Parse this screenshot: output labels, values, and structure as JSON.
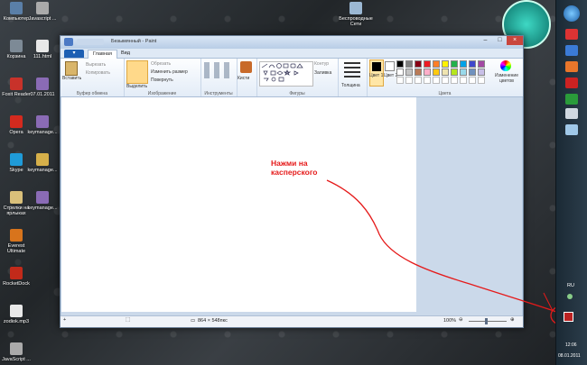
{
  "desktop": {
    "icons": [
      {
        "label": "Компьютер",
        "color": "#5a7fa8"
      },
      {
        "label": "Корзина",
        "color": "#7d8a96"
      },
      {
        "label": "Foxit Reader",
        "color": "#c8322a"
      },
      {
        "label": "Opera",
        "color": "#d42a1e"
      },
      {
        "label": "Skype",
        "color": "#1f9bd8"
      },
      {
        "label": "Стрелки на ярлыках",
        "color": "#d9c07a"
      },
      {
        "label": "Everest Ultimate",
        "color": "#d8741c"
      },
      {
        "label": "RocketDock",
        "color": "#c22a1a"
      },
      {
        "label": "zodiok.mp3",
        "color": "#e8e8e8"
      },
      {
        "label": "JavaScript ...",
        "color": "#aaaaaa"
      }
    ],
    "icons_col2": [
      {
        "label": "Javascript ...",
        "color": "#aaaaaa"
      },
      {
        "label": "111.html",
        "color": "#e8e8e8"
      },
      {
        "label": "07.01.2011",
        "color": "#8a6bb5"
      },
      {
        "label": "keymanage...",
        "color": "#8a6bb5"
      },
      {
        "label": "keymanage...",
        "color": "#d6b04a"
      },
      {
        "label": "keymanage...",
        "color": "#8a6bb5"
      }
    ],
    "top_icon_label": "Беспроводные Сети"
  },
  "paint": {
    "title": "Безымянный - Paint",
    "file_tab": "▾",
    "tabs": [
      "Главная",
      "Вид"
    ],
    "groups": {
      "clipboard": {
        "label": "Буфер обмена",
        "paste": "Вставить",
        "cut": "Вырезать",
        "copy": "Копировать"
      },
      "image": {
        "label": "Изображение",
        "select": "Выделить",
        "crop": "Обрезать",
        "resize": "Изменить размер",
        "rotate": "Повернуть"
      },
      "tools": {
        "label": "Инструменты"
      },
      "brushes": {
        "label": "Кисти"
      },
      "shapes": {
        "label": "Фигуры",
        "outline": "Контур",
        "fill": "Заливка"
      },
      "size": {
        "label": "Толщина"
      },
      "colors": {
        "label": "Цвета",
        "color1": "Цвет 1",
        "color2": "Цвет 2",
        "edit": "Изменение цветов"
      }
    },
    "palette": [
      "#000000",
      "#7f7f7f",
      "#880015",
      "#ed1c24",
      "#ff7f27",
      "#fff200",
      "#22b14c",
      "#00a2e8",
      "#3f48cc",
      "#a349a4",
      "#ffffff",
      "#c3c3c3",
      "#b97a57",
      "#ffaec9",
      "#ffc90e",
      "#efe4b0",
      "#b5e61d",
      "#99d9ea",
      "#7092be",
      "#c8bfe7"
    ],
    "status": {
      "size": "864 × 548пкс",
      "zoom": "100%"
    }
  },
  "annotation": {
    "line1": "Нажми на",
    "line2": "касперского",
    "color": "#e51a1a"
  },
  "tray": {
    "lang": "RU",
    "time": "12:06",
    "date": "08.01.2011"
  }
}
